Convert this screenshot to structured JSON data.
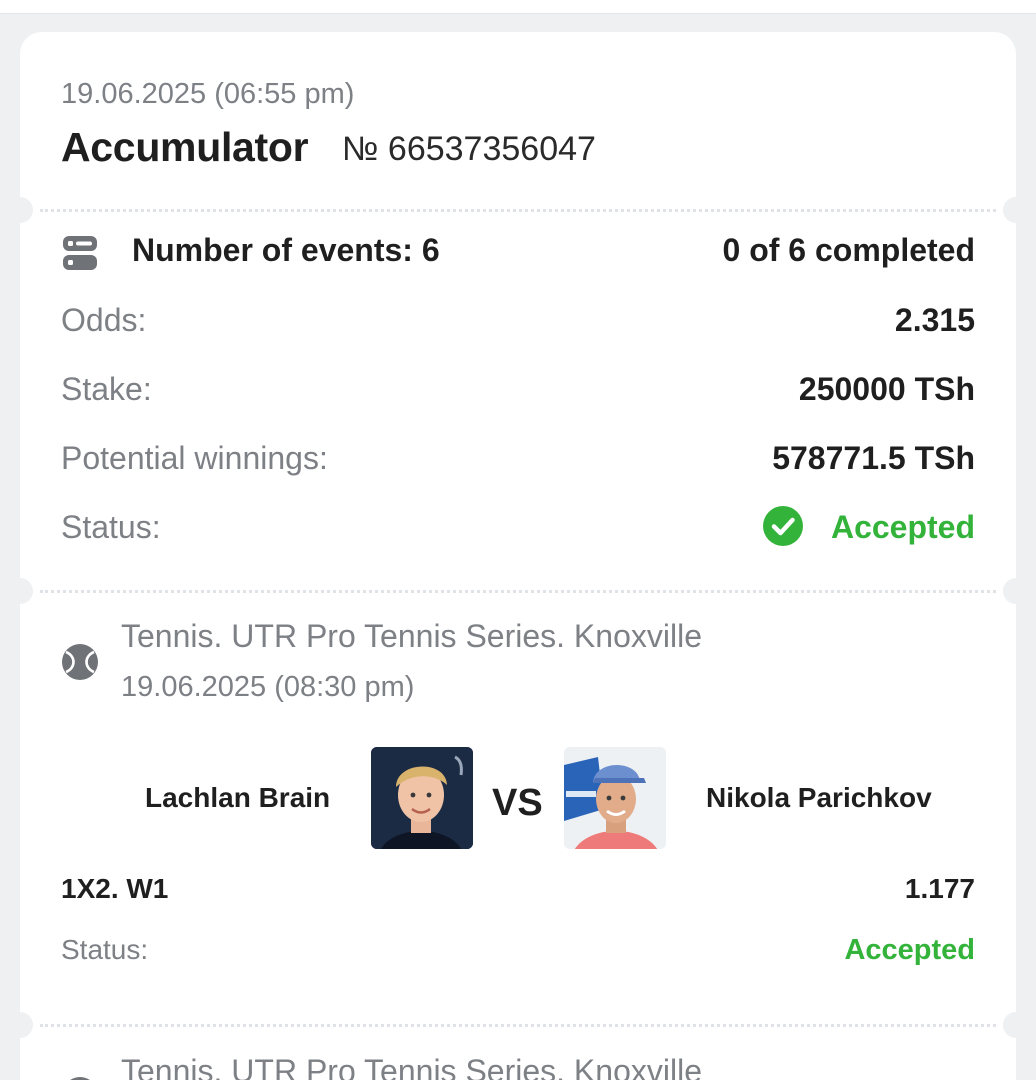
{
  "bet": {
    "date": "19.06.2025 (06:55 pm)",
    "title": "Accumulator",
    "number": "№ 66537356047"
  },
  "summary": {
    "events_label": "Number of events: 6",
    "completed": "0 of 6 completed",
    "odds_label": "Odds:",
    "odds_value": "2.315",
    "stake_label": "Stake:",
    "stake_value": "250000 TSh",
    "winnings_label": "Potential winnings:",
    "winnings_value": "578771.5 TSh",
    "status_label": "Status:",
    "status_value": "Accepted"
  },
  "events": [
    {
      "league": "Tennis. UTR Pro Tennis Series. Knoxville",
      "date": "19.06.2025 (08:30 pm)",
      "player1": "Lachlan Brain",
      "vs": "VS",
      "player2": "Nikola Parichkov",
      "market": "1X2. W1",
      "odds": "1.177",
      "status_label": "Status:",
      "status_value": "Accepted"
    },
    {
      "league": "Tennis. UTR Pro Tennis Series. Knoxville"
    }
  ],
  "icons": {
    "events": "list-icon",
    "status": "check-circle-icon",
    "sport": "tennis-ball-icon"
  },
  "colors": {
    "accent_green": "#34b33b",
    "muted_text": "#7d8085",
    "background": "#eef0f2"
  }
}
